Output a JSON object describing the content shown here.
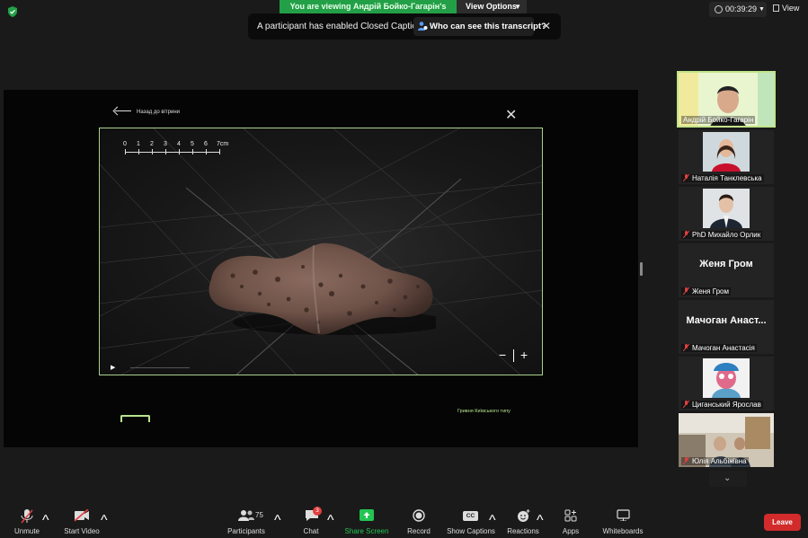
{
  "top_bar": {
    "viewing_banner": "You are viewing Андрій Бойко-Гагарін's screen",
    "view_options_label": "View Options",
    "cc_notice_text": "A participant has enabled Closed Captioning",
    "cc_link_label": "Who can see this transcript?",
    "timer": "00:39:29",
    "view_label": "View"
  },
  "shared_screen": {
    "back_label": "Назад до вітрини",
    "scale_labels": [
      "0",
      "1",
      "2",
      "3",
      "4",
      "5",
      "6",
      "7cm"
    ],
    "zoom_minus": "−",
    "zoom_plus": "+",
    "caption": "Гривня Київського типу"
  },
  "participants": [
    {
      "name": "Андрій Бойко-Гагарін",
      "muted": false,
      "type": "video"
    },
    {
      "name": "Наталія Танклевська",
      "muted": true,
      "type": "photo"
    },
    {
      "name": "PhD Михайло Орлик",
      "muted": true,
      "type": "photo"
    },
    {
      "name": "Женя Гром",
      "display": "Женя Гром",
      "muted": true,
      "type": "text"
    },
    {
      "name": "Мачоган Анастасія",
      "display": "Мачоган  Анаст...",
      "muted": true,
      "type": "text"
    },
    {
      "name": "Циганський Ярослав",
      "muted": true,
      "type": "photo"
    },
    {
      "name": "Юлія Альбінівна",
      "muted": true,
      "type": "video"
    }
  ],
  "toolbar": {
    "unmute": "Unmute",
    "start_video": "Start Video",
    "participants": "Participants",
    "participants_count": "75",
    "chat": "Chat",
    "chat_badge": "3",
    "share_screen": "Share Screen",
    "record": "Record",
    "show_captions": "Show Captions",
    "cc_icon_text": "CC",
    "reactions": "Reactions",
    "apps": "Apps",
    "whiteboards": "Whiteboards",
    "leave": "Leave"
  },
  "colors": {
    "banner_green": "#23a047",
    "share_green": "#23c552",
    "accent_border": "#c2e38a",
    "leave_red": "#d22b2b",
    "mute_red": "#e0403f"
  }
}
